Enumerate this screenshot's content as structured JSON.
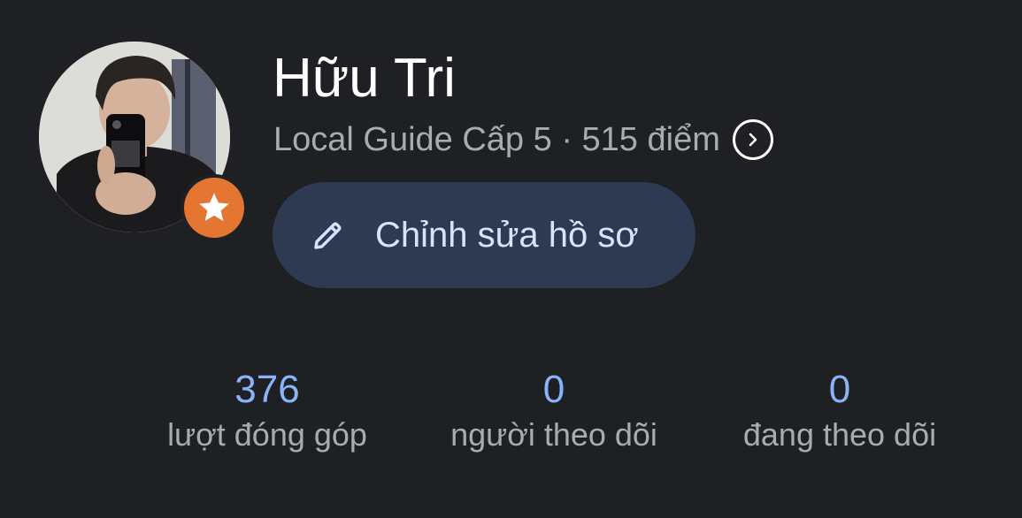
{
  "profile": {
    "name": "Hữu Tri",
    "level_text": "Local Guide Cấp 5 · 515 điểm",
    "avatar_icon": "profile-photo",
    "badge_icon": "star-icon",
    "badge_color": "#e47631"
  },
  "edit_button": {
    "label": "Chỉnh sửa hồ sơ",
    "icon": "pencil-icon"
  },
  "stats": [
    {
      "value": "376",
      "label": "lượt đóng góp"
    },
    {
      "value": "0",
      "label": "người theo dõi"
    },
    {
      "value": "0",
      "label": "đang theo dõi"
    }
  ],
  "colors": {
    "background": "#1f2024",
    "accent": "#8ab4f8",
    "button_bg": "#2e3a52"
  }
}
